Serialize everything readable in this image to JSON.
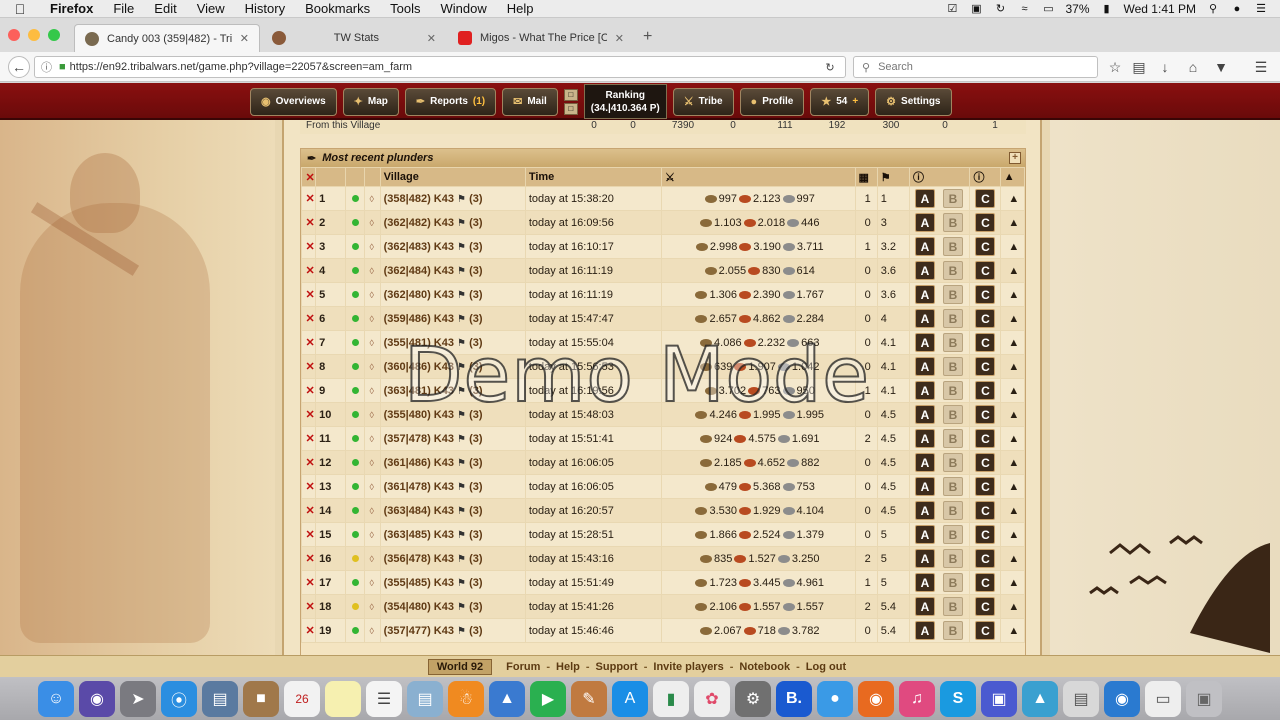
{
  "menubar": {
    "app": "Firefox",
    "items": [
      "File",
      "Edit",
      "View",
      "History",
      "Bookmarks",
      "Tools",
      "Window",
      "Help"
    ],
    "battery": "37%",
    "clock": "Wed 1:41 PM"
  },
  "tabs": [
    {
      "label": "Candy 003 (359|482) - Tri…",
      "color": "#7a6a50"
    },
    {
      "label": "TW Stats",
      "color": "#8a5a3a"
    },
    {
      "label": "Migos - What The Price [Of…",
      "color": "#e02020"
    }
  ],
  "url": "https://en92.tribalwars.net/game.php?village=22057&screen=am_farm",
  "search_placeholder": "Search",
  "game_nav": {
    "overviews": "Overviews",
    "map": "Map",
    "reports": "Reports",
    "reports_count": "(1)",
    "mail": "Mail",
    "ranking_label": "Ranking",
    "ranking_value": "(34.|410.364 P)",
    "tribe": "Tribe",
    "profile": "Profile",
    "premium": "54",
    "settings": "Settings"
  },
  "prev_row": {
    "label": "From this Village",
    "values": [
      "0",
      "0",
      "7390",
      "0",
      "111",
      "192",
      "300",
      "0",
      "1"
    ]
  },
  "panel": {
    "title": "Most recent plunders",
    "headers": {
      "village": "Village",
      "time": "Time"
    },
    "rows": [
      {
        "n": "1",
        "dot": "green",
        "village": "(358|482) K43",
        "count": "(3)",
        "time": "today at 15:38:20",
        "wood": "997",
        "clay": "2.123",
        "iron": "997",
        "walls": "1",
        "dist": "1"
      },
      {
        "n": "2",
        "dot": "green",
        "village": "(362|482) K43",
        "count": "(3)",
        "time": "today at 16:09:56",
        "wood": "1.103",
        "clay": "2.018",
        "iron": "446",
        "walls": "0",
        "dist": "3"
      },
      {
        "n": "3",
        "dot": "green",
        "village": "(362|483) K43",
        "count": "(3)",
        "time": "today at 16:10:17",
        "wood": "2.998",
        "clay": "3.190",
        "iron": "3.711",
        "walls": "1",
        "dist": "3.2"
      },
      {
        "n": "4",
        "dot": "green",
        "village": "(362|484) K43",
        "count": "(3)",
        "time": "today at 16:11:19",
        "wood": "2.055",
        "clay": "830",
        "iron": "614",
        "walls": "0",
        "dist": "3.6"
      },
      {
        "n": "5",
        "dot": "green",
        "village": "(362|480) K43",
        "count": "(3)",
        "time": "today at 16:11:19",
        "wood": "1.306",
        "clay": "2.390",
        "iron": "1.767",
        "walls": "0",
        "dist": "3.6"
      },
      {
        "n": "6",
        "dot": "green",
        "village": "(359|486) K43",
        "count": "(3)",
        "time": "today at 15:47:47",
        "wood": "2.657",
        "clay": "4.862",
        "iron": "2.284",
        "walls": "0",
        "dist": "4"
      },
      {
        "n": "7",
        "dot": "green",
        "village": "(355|481) K43",
        "count": "(3)",
        "time": "today at 15:55:04",
        "wood": "4.086",
        "clay": "2.232",
        "iron": "663",
        "walls": "0",
        "dist": "4.1"
      },
      {
        "n": "8",
        "dot": "green",
        "village": "(360|486) K43",
        "count": "(3)",
        "time": "today at 15:56:53",
        "wood": "639",
        "clay": "1.907",
        "iron": "1.042",
        "walls": "0",
        "dist": "4.1"
      },
      {
        "n": "9",
        "dot": "green",
        "village": "(363|481) K43",
        "count": "(3)",
        "time": "today at 16:19:56",
        "wood": "3.702",
        "clay": "763",
        "iron": "950",
        "walls": "1",
        "dist": "4.1"
      },
      {
        "n": "10",
        "dot": "green",
        "village": "(355|480) K43",
        "count": "(3)",
        "time": "today at 15:48:03",
        "wood": "4.246",
        "clay": "1.995",
        "iron": "1.995",
        "walls": "0",
        "dist": "4.5"
      },
      {
        "n": "11",
        "dot": "green",
        "village": "(357|478) K43",
        "count": "(3)",
        "time": "today at 15:51:41",
        "wood": "924",
        "clay": "4.575",
        "iron": "1.691",
        "walls": "2",
        "dist": "4.5"
      },
      {
        "n": "12",
        "dot": "green",
        "village": "(361|486) K43",
        "count": "(3)",
        "time": "today at 16:06:05",
        "wood": "2.185",
        "clay": "4.652",
        "iron": "882",
        "walls": "0",
        "dist": "4.5"
      },
      {
        "n": "13",
        "dot": "green",
        "village": "(361|478) K43",
        "count": "(3)",
        "time": "today at 16:06:05",
        "wood": "479",
        "clay": "5.368",
        "iron": "753",
        "walls": "0",
        "dist": "4.5"
      },
      {
        "n": "14",
        "dot": "green",
        "village": "(363|484) K43",
        "count": "(3)",
        "time": "today at 16:20:57",
        "wood": "3.530",
        "clay": "1.929",
        "iron": "4.104",
        "walls": "0",
        "dist": "4.5"
      },
      {
        "n": "15",
        "dot": "green",
        "village": "(363|485) K43",
        "count": "(3)",
        "time": "today at 15:28:51",
        "wood": "1.866",
        "clay": "2.524",
        "iron": "1.379",
        "walls": "0",
        "dist": "5"
      },
      {
        "n": "16",
        "dot": "yellow",
        "village": "(356|478) K43",
        "count": "(3)",
        "time": "today at 15:43:16",
        "wood": "835",
        "clay": "1.527",
        "iron": "3.250",
        "walls": "2",
        "dist": "5"
      },
      {
        "n": "17",
        "dot": "green",
        "village": "(355|485) K43",
        "count": "(3)",
        "time": "today at 15:51:49",
        "wood": "1.723",
        "clay": "3.445",
        "iron": "4.961",
        "walls": "1",
        "dist": "5"
      },
      {
        "n": "18",
        "dot": "yellow",
        "village": "(354|480) K43",
        "count": "(3)",
        "time": "today at 15:41:26",
        "wood": "2.106",
        "clay": "1.557",
        "iron": "1.557",
        "walls": "2",
        "dist": "5.4"
      },
      {
        "n": "19",
        "dot": "green",
        "village": "(357|477) K43",
        "count": "(3)",
        "time": "today at 15:46:46",
        "wood": "2.067",
        "clay": "718",
        "iron": "3.782",
        "walls": "0",
        "dist": "5.4"
      }
    ],
    "btn_a": "A",
    "btn_b": "B",
    "btn_c": "C"
  },
  "watermark": "Demo Mode",
  "footer": {
    "world": "World 92",
    "links": [
      "Forum",
      "Help",
      "Support",
      "Invite players",
      "Notebook",
      "Log out"
    ]
  },
  "colors": {
    "nav_red": "#7a0c0c",
    "dot_green": "#33b533",
    "dot_yellow": "#e0c020",
    "delete_red": "#c01010"
  }
}
